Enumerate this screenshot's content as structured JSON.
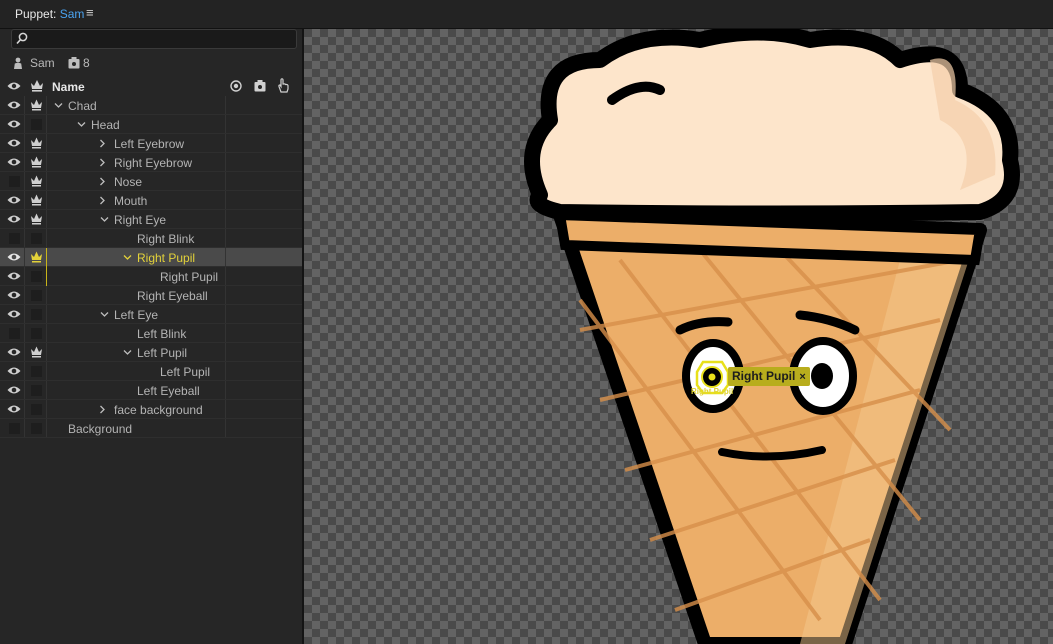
{
  "panel": {
    "label": "Puppet:",
    "puppet_name": "Sam",
    "menu_icon": "hamburger-menu-icon"
  },
  "search": {
    "placeholder": "",
    "value": ""
  },
  "info": {
    "puppet_name": "Sam",
    "rig_count": "8"
  },
  "header": {
    "name_label": "Name"
  },
  "colors": {
    "accent_blue": "#4aa3f0",
    "selected_yellow": "#e3d23a",
    "tag_bg": "#b8ad1d"
  },
  "rows": [
    {
      "label": "Chad",
      "eye": true,
      "crown": true,
      "chevron": "down"
    },
    {
      "label": "Head",
      "eye": true,
      "crown": false,
      "chevron": "down"
    },
    {
      "label": "Left Eyebrow",
      "eye": true,
      "crown": true,
      "chevron": "right"
    },
    {
      "label": "Right Eyebrow",
      "eye": true,
      "crown": true,
      "chevron": "right"
    },
    {
      "label": "Nose",
      "eye": false,
      "crown": true,
      "chevron": "right"
    },
    {
      "label": "Mouth",
      "eye": true,
      "crown": true,
      "chevron": "right"
    },
    {
      "label": "Right Eye",
      "eye": true,
      "crown": true,
      "chevron": "down"
    },
    {
      "label": "Right Blink",
      "eye": false,
      "crown": false,
      "chevron": "none"
    },
    {
      "label": "Right Pupil",
      "eye": true,
      "crown": true,
      "chevron": "down",
      "selected": true
    },
    {
      "label": "Right Pupil",
      "eye": true,
      "crown": false,
      "chevron": "none"
    },
    {
      "label": "Right Eyeball",
      "eye": true,
      "crown": false,
      "chevron": "none"
    },
    {
      "label": "Left Eye",
      "eye": true,
      "crown": false,
      "chevron": "down"
    },
    {
      "label": "Left Blink",
      "eye": false,
      "crown": false,
      "chevron": "none"
    },
    {
      "label": "Left Pupil",
      "eye": true,
      "crown": true,
      "chevron": "down"
    },
    {
      "label": "Left Pupil",
      "eye": true,
      "crown": false,
      "chevron": "none"
    },
    {
      "label": "Left Eyeball",
      "eye": true,
      "crown": false,
      "chevron": "none"
    },
    {
      "label": "face background",
      "eye": true,
      "crown": false,
      "chevron": "right"
    },
    {
      "label": "Background",
      "eye": false,
      "crown": false,
      "chevron": "none"
    }
  ],
  "canvas": {
    "tag_label": "Right Pupil",
    "tag_close": "×",
    "handle_label": "Right Pupil"
  }
}
